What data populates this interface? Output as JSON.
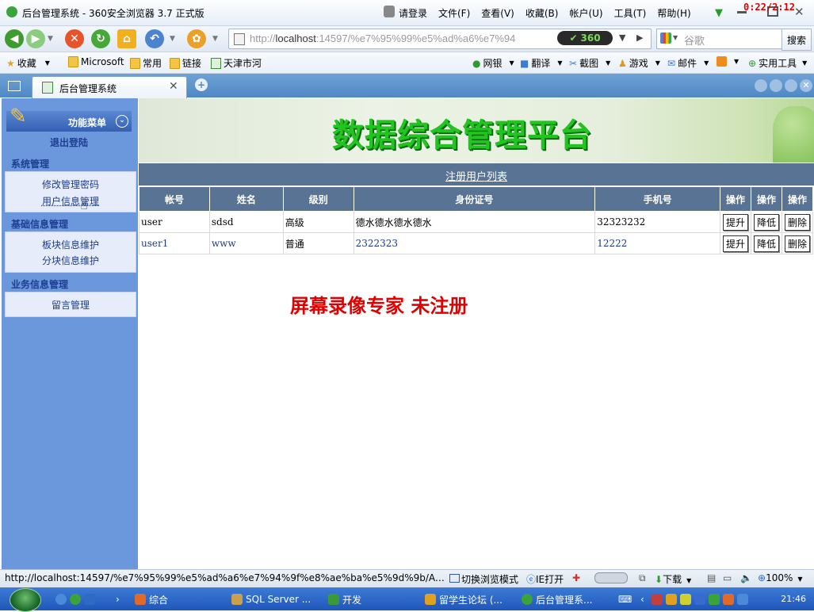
{
  "browser": {
    "title": "后台管理系统 - 360安全浏览器 3.7 正式版",
    "login": "请登录",
    "menu": [
      "文件(F)",
      "查看(V)",
      "收藏(B)",
      "帐户(U)",
      "工具(T)",
      "帮助(H)"
    ],
    "rec_timer": "0:22/2:12",
    "address": {
      "prefix": "http://",
      "host": "localhost",
      "rest": ":14597/%e7%95%99%e5%ad%a6%e7%94"
    },
    "badge": "360",
    "search_placeholder": "谷歌",
    "search_button": "搜索",
    "bookmarks": [
      "收藏",
      "Microsoft",
      "常用",
      "链接",
      "天津市河"
    ],
    "tools": [
      "网银",
      "翻译",
      "截图",
      "游戏",
      "邮件",
      "实用工具"
    ],
    "tab_title": "后台管理系统"
  },
  "sidebar": {
    "header": "功能菜单",
    "logout": "退出登陆",
    "sections": [
      {
        "title": "系统管理",
        "items": [
          "修改管理密码",
          "用户信息管理"
        ]
      },
      {
        "title": "基础信息管理",
        "items": [
          "板块信息维护",
          "分块信息维护"
        ]
      },
      {
        "title": "业务信息管理",
        "items": [
          "留言管理"
        ]
      }
    ]
  },
  "main": {
    "banner_title": "数据综合管理平台",
    "list_title": "注册用户列表",
    "columns": [
      "帐号",
      "姓名",
      "级别",
      "身份证号",
      "手机号",
      "操作",
      "操作",
      "操作"
    ],
    "rows": [
      {
        "account": "user",
        "name": "sdsd",
        "level": "高级",
        "id_card": "德水德水德水德水",
        "phone": "32323232"
      },
      {
        "account": "user1",
        "name": "www",
        "level": "普通",
        "id_card": "2322323",
        "phone": "12222"
      }
    ],
    "actions": [
      "提升",
      "降低",
      "删除"
    ],
    "watermark": "屏幕录像专家  未注册"
  },
  "status": {
    "url": "http://localhost:14597/%e7%95%99%e5%ad%a6%e7%94%9f%e8%ae%ba%e5%9d%9b/Adm...",
    "switch_mode": "切换浏览模式",
    "ie_open": "IE打开",
    "download": "下载",
    "zoom": "100%"
  },
  "taskbar": {
    "items": [
      "综合",
      "SQL Server ...",
      "开发",
      "留学生论坛 (...",
      "后台管理系..."
    ],
    "clock": "21:46"
  },
  "colors": {
    "sidebar": "#6b97dd",
    "table_header": "#587394",
    "banner_text": "#22c422",
    "watermark": "#e00000"
  }
}
